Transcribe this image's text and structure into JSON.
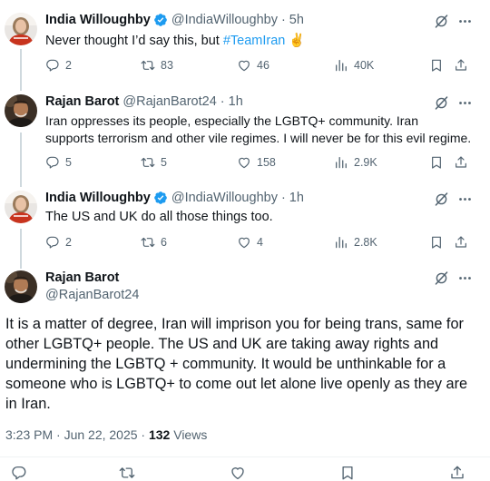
{
  "tweets": [
    {
      "name": "India Willoughby",
      "handle": "@IndiaWilloughby",
      "time": "· 5h",
      "text_prefix": "Never thought I’d say this, but ",
      "hashtag": "#TeamIran",
      "emoji": " ✌",
      "replies": "2",
      "reposts": "83",
      "likes": "46",
      "views": "40K"
    },
    {
      "name": "Rajan Barot",
      "handle": "@RajanBarot24",
      "time": "· 1h",
      "text_line1": "Iran oppresses its people, especially the LGBTQ+ community.  Iran",
      "text_line2": "supports terrorism and other vile regimes. I will never be for this evil regime.",
      "replies": "5",
      "reposts": "5",
      "likes": "158",
      "views": "2.9K"
    },
    {
      "name": "India Willoughby",
      "handle": "@IndiaWilloughby",
      "time": "· 1h",
      "text": "The US and UK do all those things too.",
      "replies": "2",
      "reposts": "6",
      "likes": "4",
      "views": "2.8K"
    }
  ],
  "main_tweet": {
    "name": "Rajan Barot",
    "handle": "@RajanBarot24",
    "text": "It is a matter of degree, Iran will imprison you for being trans, same for other LGBTQ+ people. The US and UK are taking away rights and undermining the LGBTQ + community. It would be unthinkable for a someone who is LGBTQ+ to come out let alone live openly as they are in Iran.",
    "timestamp": "3:23 PM · Jun 22, 2025 · ",
    "views_count": "132",
    "views_label": " Views"
  },
  "icons": {
    "verified": "verified-badge-icon",
    "grok": "grok-icon",
    "more": "more-icon",
    "reply": "reply-icon",
    "repost": "repost-icon",
    "like": "like-icon",
    "views": "views-icon",
    "bookmark": "bookmark-icon",
    "share": "share-icon"
  },
  "colors": {
    "accent": "#1d9bf0",
    "text": "#0f1419",
    "muted": "#536471"
  }
}
